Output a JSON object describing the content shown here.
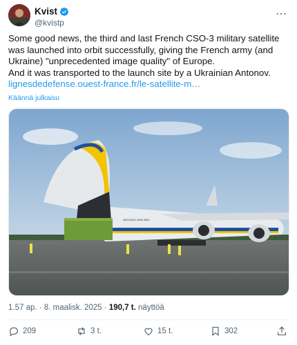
{
  "author": {
    "display_name": "Kvist",
    "handle": "@kvistp",
    "avatar_icon": "profile-picture"
  },
  "colors": {
    "link": "#1d9bf0",
    "verified": "#1d9bf0",
    "secondary_text": "#536471"
  },
  "tweet": {
    "paragraph_1": "Some good news, the third and last French CSO-3 military satellite was launched into orbit successfully, giving the French army (and Ukraine) \"unprecedented image quality\" of Europe.",
    "paragraph_2": "And it was transported to the launch site by a Ukrainian Antonov.",
    "link_text": "lignesdedefense.ouest-france.fr/le-satellite-m…",
    "translate_label": "Käännä julkaisu"
  },
  "media": {
    "aircraft_label": "ANTONOV AIRLINES"
  },
  "meta": {
    "time": "1.57 ap.",
    "separator": "·",
    "date": "8. maalisk. 2025",
    "views_count": "190,7 t.",
    "views_label": "näyttöä"
  },
  "actions": {
    "replies": "209",
    "reposts": "3 t.",
    "likes": "15 t.",
    "bookmarks": "302"
  }
}
